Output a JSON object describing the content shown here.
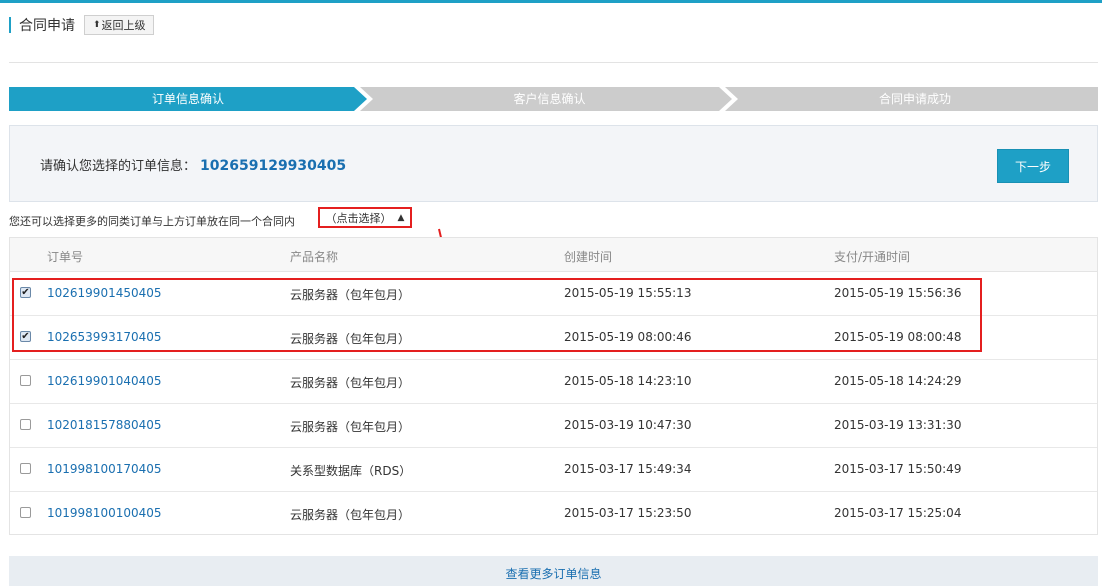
{
  "header": {
    "title": "合同申请",
    "back_label": "返回上级"
  },
  "steps": [
    {
      "label": "订单信息确认",
      "active": true
    },
    {
      "label": "客户信息确认",
      "active": false
    },
    {
      "label": "合同申请成功",
      "active": false
    }
  ],
  "confirm": {
    "prompt": "请确认您选择的订单信息：",
    "order_id": "102659129930405",
    "next_label": "下一步"
  },
  "more_hint": "您还可以选择更多的同类订单与上方订单放在同一个合同内",
  "select_toggle_label": "（点击选择）",
  "table": {
    "headers": [
      "订单号",
      "产品名称",
      "创建时间",
      "支付/开通时间"
    ],
    "rows": [
      {
        "checked": true,
        "order": "102619901450405",
        "product": "云服务器（包年包月）",
        "created": "2015-05-19 15:55:13",
        "paid": "2015-05-19 15:56:36"
      },
      {
        "checked": true,
        "order": "102653993170405",
        "product": "云服务器（包年包月）",
        "created": "2015-05-19 08:00:46",
        "paid": "2015-05-19 08:00:48"
      },
      {
        "checked": false,
        "order": "102619901040405",
        "product": "云服务器（包年包月）",
        "created": "2015-05-18 14:23:10",
        "paid": "2015-05-18 14:24:29"
      },
      {
        "checked": false,
        "order": "102018157880405",
        "product": "云服务器（包年包月）",
        "created": "2015-03-19 10:47:30",
        "paid": "2015-03-19 13:31:30"
      },
      {
        "checked": false,
        "order": "101998100170405",
        "product": "关系型数据库（RDS）",
        "created": "2015-03-17 15:49:34",
        "paid": "2015-03-17 15:50:49"
      },
      {
        "checked": false,
        "order": "101998100100405",
        "product": "云服务器（包年包月）",
        "created": "2015-03-17 15:23:50",
        "paid": "2015-03-17 15:25:04"
      }
    ]
  },
  "view_more_label": "查看更多订单信息",
  "colors": {
    "accent": "#1ea0c6",
    "link": "#1a6fb0",
    "step_inactive": "#cccccc",
    "annotation": "#e41f1f"
  }
}
